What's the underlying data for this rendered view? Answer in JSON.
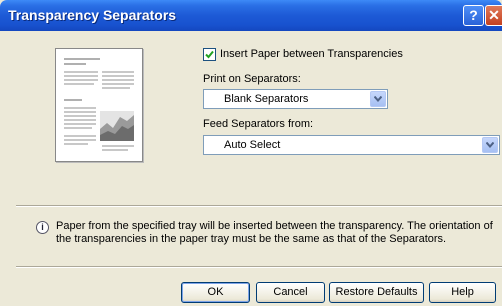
{
  "window": {
    "title": "Transparency Separators",
    "help_glyph": "?",
    "close_glyph": "✕"
  },
  "options": {
    "insert_paper_label": "Insert Paper between Transparencies",
    "insert_paper_checked": true,
    "print_on_label": "Print on Separators:",
    "print_on_value": "Blank Separators",
    "feed_from_label": "Feed Separators from:",
    "feed_from_value": "Auto Select"
  },
  "info": {
    "icon": "info-icon",
    "text": "Paper from the specified tray will be inserted between the transparency. The orientation of the transparencies in the paper tray must be the same as that of the Separators."
  },
  "buttons": {
    "ok": "OK",
    "cancel": "Cancel",
    "restore": "Restore Defaults",
    "help": "Help"
  }
}
